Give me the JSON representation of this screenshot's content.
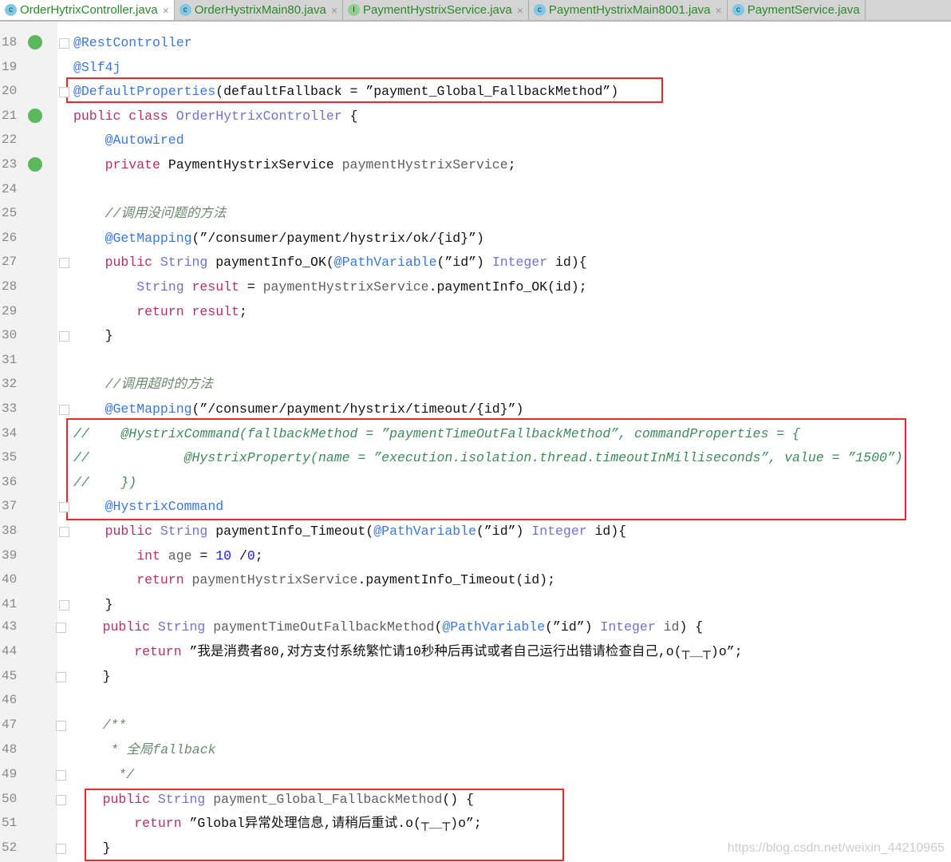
{
  "tabs": [
    {
      "label": "OrderHytrixController.java",
      "icon": "class-icon",
      "active": true,
      "close": true
    },
    {
      "label": "OrderHystrixMain80.java",
      "icon": "run-class-icon",
      "active": false,
      "close": true
    },
    {
      "label": "PaymentHystrixService.java",
      "icon": "interface-icon",
      "active": false,
      "close": true
    },
    {
      "label": "PaymentHystrixMain8001.java",
      "icon": "run-class-icon",
      "active": false,
      "close": true
    },
    {
      "label": "PaymentService.java",
      "icon": "class-icon",
      "active": false,
      "close": false
    }
  ],
  "lines": [
    {
      "n": "18",
      "indent": 0,
      "tokens": [
        [
          "a",
          "@RestController"
        ]
      ]
    },
    {
      "n": "19",
      "indent": 0,
      "tokens": [
        [
          "a",
          "@Slf4j"
        ]
      ]
    },
    {
      "n": "20",
      "indent": 0,
      "tokens": [
        [
          "a",
          "@DefaultProperties"
        ],
        [
          "p",
          "(defaultFallback = ”payment_Global_FallbackMethod”)"
        ]
      ]
    },
    {
      "n": "21",
      "indent": 0,
      "tokens": [
        [
          "k",
          "public class "
        ],
        [
          "t",
          "OrderHytrixController"
        ],
        [
          "p",
          " {"
        ]
      ]
    },
    {
      "n": "22",
      "indent": 4,
      "tokens": [
        [
          "a",
          "@Autowired"
        ]
      ]
    },
    {
      "n": "23",
      "indent": 4,
      "tokens": [
        [
          "k",
          "private "
        ],
        [
          "p",
          "PaymentHystrixService "
        ],
        [
          "f",
          "paymentHystrixService"
        ],
        [
          "p",
          ";"
        ]
      ]
    },
    {
      "n": "24",
      "indent": 0,
      "tokens": []
    },
    {
      "n": "25",
      "indent": 4,
      "tokens": [
        [
          "c",
          "//调用没问题的方法"
        ]
      ]
    },
    {
      "n": "26",
      "indent": 4,
      "tokens": [
        [
          "a",
          "@GetMapping"
        ],
        [
          "p",
          "(”/consumer/payment/hystrix/ok/{id}”)"
        ]
      ]
    },
    {
      "n": "27",
      "indent": 4,
      "tokens": [
        [
          "k",
          "public "
        ],
        [
          "t",
          "String "
        ],
        [
          "p",
          "paymentInfo_OK("
        ],
        [
          "a",
          "@PathVariable"
        ],
        [
          "p",
          "(”id”) "
        ],
        [
          "t",
          "Integer "
        ],
        [
          "p",
          "id){"
        ]
      ]
    },
    {
      "n": "28",
      "indent": 8,
      "tokens": [
        [
          "t",
          "String "
        ],
        [
          "k",
          "result "
        ],
        [
          "p",
          "= "
        ],
        [
          "f",
          "paymentHystrixService"
        ],
        [
          "p",
          ".paymentInfo_OK(id);"
        ]
      ]
    },
    {
      "n": "29",
      "indent": 8,
      "tokens": [
        [
          "k",
          "return "
        ],
        [
          "k",
          "result"
        ],
        [
          "p",
          ";"
        ]
      ]
    },
    {
      "n": "30",
      "indent": 4,
      "tokens": [
        [
          "p",
          "}"
        ]
      ]
    },
    {
      "n": "31",
      "indent": 0,
      "tokens": []
    },
    {
      "n": "32",
      "indent": 4,
      "tokens": [
        [
          "c",
          "//调用超时的方法"
        ]
      ]
    },
    {
      "n": "33",
      "indent": 4,
      "tokens": [
        [
          "a",
          "@GetMapping"
        ],
        [
          "p",
          "(”/consumer/payment/hystrix/timeout/{id}”)"
        ]
      ]
    },
    {
      "n": "34",
      "indent": 0,
      "tokens": [
        [
          "cc",
          "//    @HystrixCommand(fallbackMethod = ”paymentTimeOutFallbackMethod”, commandProperties = {"
        ]
      ]
    },
    {
      "n": "35",
      "indent": 0,
      "tokens": [
        [
          "cc",
          "//            @HystrixProperty(name = ”execution.isolation.thread.timeoutInMilliseconds”, value = ”1500”)"
        ]
      ]
    },
    {
      "n": "36",
      "indent": 0,
      "tokens": [
        [
          "cc",
          "//    })"
        ]
      ]
    },
    {
      "n": "37",
      "indent": 4,
      "tokens": [
        [
          "a",
          "@HystrixCommand"
        ]
      ]
    },
    {
      "n": "38",
      "indent": 4,
      "tokens": [
        [
          "k",
          "public "
        ],
        [
          "t",
          "String "
        ],
        [
          "p",
          "paymentInfo_Timeout("
        ],
        [
          "a",
          "@PathVariable"
        ],
        [
          "p",
          "(”id”) "
        ],
        [
          "t",
          "Integer "
        ],
        [
          "p",
          "id){"
        ]
      ]
    },
    {
      "n": "39",
      "indent": 8,
      "tokens": [
        [
          "k",
          "int "
        ],
        [
          "f",
          "age "
        ],
        [
          "p",
          "= "
        ],
        [
          "n",
          "10 "
        ],
        [
          "p",
          "/"
        ],
        [
          "n",
          "0"
        ],
        [
          "p",
          ";"
        ]
      ]
    },
    {
      "n": "40",
      "indent": 8,
      "tokens": [
        [
          "k",
          "return "
        ],
        [
          "f",
          "paymentHystrixService"
        ],
        [
          "p",
          ".paymentInfo_Timeout(id);"
        ]
      ]
    },
    {
      "n": "41",
      "indent": 4,
      "tokens": [
        [
          "p",
          "}"
        ]
      ]
    },
    {
      "n": "43",
      "indent": 4,
      "tokens": [
        [
          "k",
          "public "
        ],
        [
          "t",
          "String "
        ],
        [
          "f",
          "paymentTimeOutFallbackMethod"
        ],
        [
          "p",
          "("
        ],
        [
          "a",
          "@PathVariable"
        ],
        [
          "p",
          "(”id”) "
        ],
        [
          "t",
          "Integer "
        ],
        [
          "f",
          "id"
        ],
        [
          "p",
          ") {"
        ]
      ]
    },
    {
      "n": "44",
      "indent": 8,
      "tokens": [
        [
          "k",
          "return "
        ],
        [
          "s",
          "”我是消费者80,对方支付系统繁忙请10秒种后再试或者自己运行出错请检查自己,o(┬＿┬)o”;"
        ]
      ]
    },
    {
      "n": "45",
      "indent": 4,
      "tokens": [
        [
          "p",
          "}"
        ]
      ]
    },
    {
      "n": "46",
      "indent": 0,
      "tokens": []
    },
    {
      "n": "47",
      "indent": 4,
      "tokens": [
        [
          "c",
          "/**"
        ]
      ]
    },
    {
      "n": "48",
      "indent": 4,
      "tokens": [
        [
          "c",
          " * 全局fallback"
        ]
      ]
    },
    {
      "n": "49",
      "indent": 4,
      "tokens": [
        [
          "c",
          "  */"
        ]
      ]
    },
    {
      "n": "50",
      "indent": 4,
      "tokens": [
        [
          "k",
          "public "
        ],
        [
          "t",
          "String "
        ],
        [
          "f",
          "payment_Global_FallbackMethod"
        ],
        [
          "p",
          "() {"
        ]
      ]
    },
    {
      "n": "51",
      "indent": 8,
      "tokens": [
        [
          "k",
          "return "
        ],
        [
          "s",
          "”Global异常处理信息,请稍后重试.o(┬＿┬)o”;"
        ]
      ]
    },
    {
      "n": "52",
      "indent": 4,
      "tokens": [
        [
          "p",
          "}"
        ]
      ]
    }
  ],
  "watermark": "https://blog.csdn.net/weixin_44210965"
}
